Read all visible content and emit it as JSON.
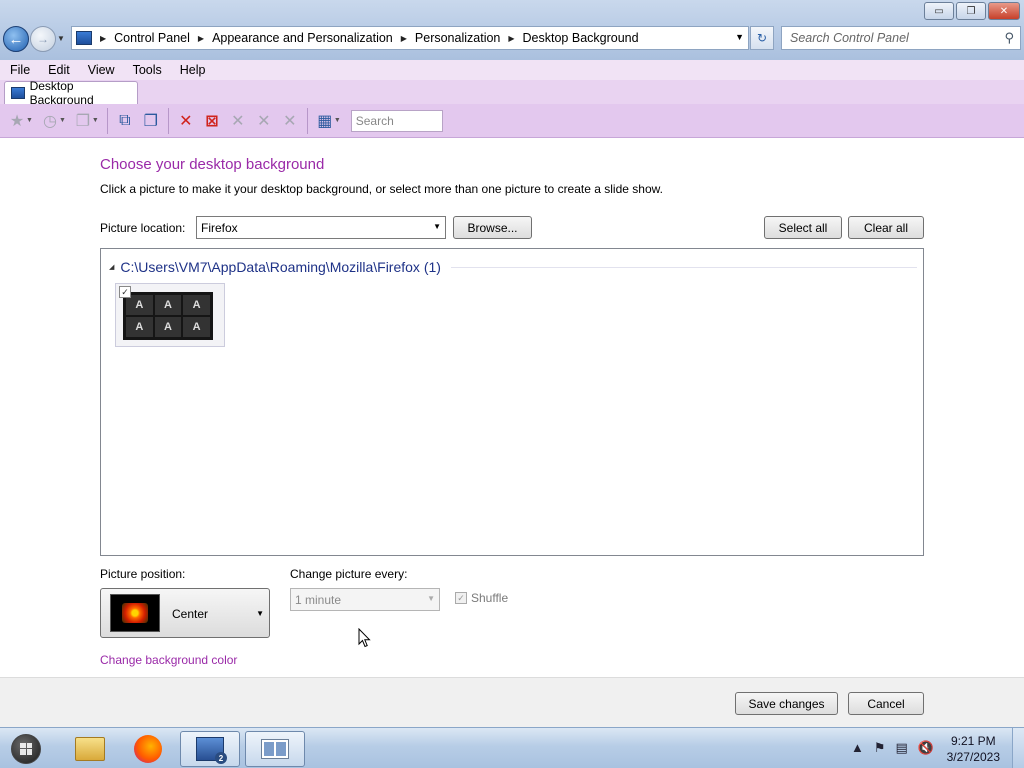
{
  "window": {
    "minimize_glyph": "▭",
    "restore_glyph": "❐",
    "close_glyph": "✕"
  },
  "address": {
    "crumbs": [
      "Control Panel",
      "Appearance and Personalization",
      "Personalization",
      "Desktop Background"
    ],
    "search_placeholder": "Search Control Panel"
  },
  "menu": [
    "File",
    "Edit",
    "View",
    "Tools",
    "Help"
  ],
  "tab": {
    "label": "Desktop Background"
  },
  "toolbar": {
    "search_placeholder": "Search"
  },
  "main": {
    "heading": "Choose your desktop background",
    "subtext": "Click a picture to make it your desktop background, or select more than one picture to create a slide show.",
    "picture_location_label": "Picture location:",
    "picture_location_value": "Firefox",
    "browse_label": "Browse...",
    "select_all_label": "Select all",
    "clear_all_label": "Clear all",
    "group_header": "C:\\Users\\VM7\\AppData\\Roaming\\Mozilla\\Firefox (1)",
    "thumbnail_letters": [
      "A",
      "A",
      "A",
      "A",
      "A",
      "A"
    ],
    "picture_position_label": "Picture position:",
    "picture_position_value": "Center",
    "change_every_label": "Change picture every:",
    "change_every_value": "1 minute",
    "shuffle_label": "Shuffle",
    "change_bg_color_link": "Change background color",
    "save_label": "Save changes",
    "cancel_label": "Cancel"
  },
  "taskbar": {
    "time": "9:21 PM",
    "date": "3/27/2023",
    "cpl_badge": "2"
  },
  "colors": {
    "accent_purple": "#9a2aa8",
    "group_header": "#1e3287",
    "toolbar_bg": "#e3c8ee"
  }
}
